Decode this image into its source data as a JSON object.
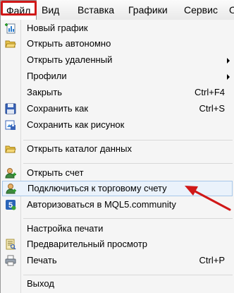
{
  "menubar": {
    "items": [
      {
        "label": "Файл"
      },
      {
        "label": "Вид"
      },
      {
        "label": "Вставка"
      },
      {
        "label": "Графики"
      },
      {
        "label": "Сервис"
      },
      {
        "label": "О"
      }
    ]
  },
  "menu": {
    "items": [
      {
        "label": "Новый график",
        "icon": "new-chart-icon"
      },
      {
        "label": "Открыть автономно",
        "icon": "open-folder-icon"
      },
      {
        "label": "Открыть удаленный",
        "submenu": true
      },
      {
        "label": "Профили",
        "submenu": true
      },
      {
        "label": "Закрыть",
        "shortcut": "Ctrl+F4"
      },
      {
        "label": "Сохранить как",
        "shortcut": "Ctrl+S",
        "icon": "save-icon"
      },
      {
        "label": "Сохранить как рисунок",
        "icon": "save-picture-icon"
      },
      {
        "label": "Открыть каталог данных",
        "icon": "data-folder-icon"
      },
      {
        "label": "Открыть счет",
        "icon": "open-account-icon"
      },
      {
        "label": "Подключиться к торговому счету",
        "icon": "login-account-icon"
      },
      {
        "label": "Авторизоваться в MQL5.community",
        "icon": "mql5-icon"
      },
      {
        "label": "Настройка печати"
      },
      {
        "label": "Предварительный просмотр",
        "icon": "print-preview-icon"
      },
      {
        "label": "Печать",
        "shortcut": "Ctrl+P",
        "icon": "printer-icon"
      },
      {
        "label": "Выход"
      }
    ]
  },
  "colors": {
    "highlight_border": "#a8c8ea",
    "highlight_fill": "#eaf2fb",
    "annotation_red": "#d01818"
  }
}
